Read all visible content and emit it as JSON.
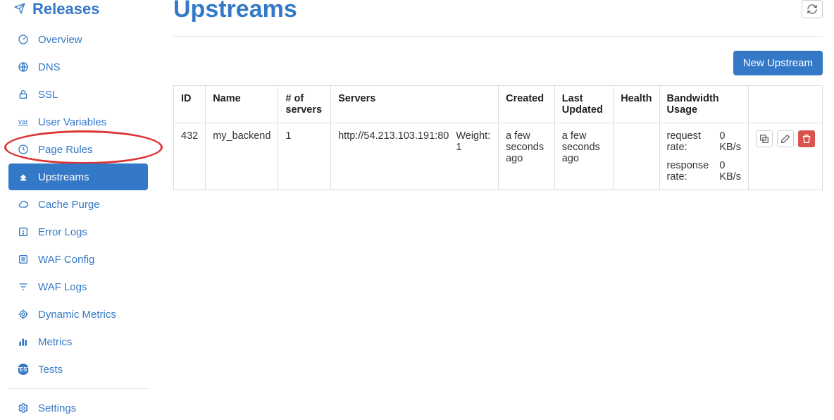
{
  "sidebar": {
    "heading": "Releases",
    "items": [
      {
        "label": "Overview",
        "icon": "dashboard-icon"
      },
      {
        "label": "DNS",
        "icon": "globe-icon"
      },
      {
        "label": "SSL",
        "icon": "lock-icon"
      },
      {
        "label": "User Variables",
        "icon": "var-icon"
      },
      {
        "label": "Page Rules",
        "icon": "clock-icon"
      },
      {
        "label": "Upstreams",
        "icon": "chevrons-up-icon"
      },
      {
        "label": "Cache Purge",
        "icon": "cloud-icon"
      },
      {
        "label": "Error Logs",
        "icon": "alert-icon"
      },
      {
        "label": "WAF Config",
        "icon": "list-icon"
      },
      {
        "label": "WAF Logs",
        "icon": "filter-icon"
      },
      {
        "label": "Dynamic Metrics",
        "icon": "radar-icon"
      },
      {
        "label": "Metrics",
        "icon": "bar-chart-icon"
      },
      {
        "label": "Tests",
        "icon": "test-badge-icon"
      }
    ],
    "settings_label": "Settings"
  },
  "page": {
    "title": "Upstreams",
    "new_button": "New Upstream"
  },
  "table": {
    "headers": {
      "id": "ID",
      "name": "Name",
      "servers_count": "# of servers",
      "servers": "Servers",
      "created": "Created",
      "updated": "Last Updated",
      "health": "Health",
      "bandwidth": "Bandwidth Usage"
    },
    "rows": [
      {
        "id": "432",
        "name": "my_backend",
        "servers_count": "1",
        "server_url": "http://54.213.103.191:80",
        "server_weight": "Weight: 1",
        "created": "a few seconds ago",
        "updated": "a few seconds ago",
        "health": "",
        "bw_req_label": "request rate:",
        "bw_req_val": "0 KB/s",
        "bw_res_label": "response rate:",
        "bw_res_val": "0 KB/s"
      }
    ]
  }
}
